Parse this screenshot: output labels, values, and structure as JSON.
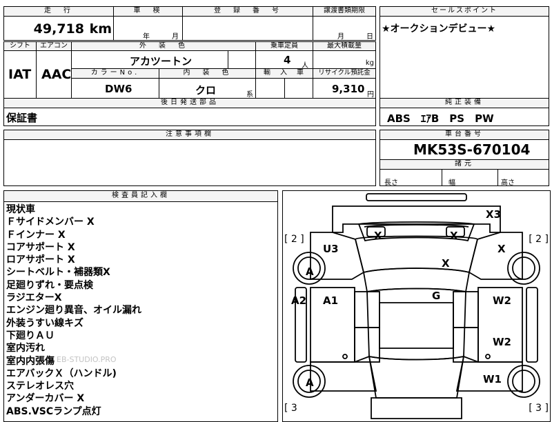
{
  "header": {
    "mileage_label": "走　行",
    "shaken_label": "車　検",
    "registration_label": "登　録　番　号",
    "transfer_label": "譲渡書類期限",
    "sales_label": "セールスポイント",
    "mileage_value": "49,718",
    "mileage_unit": "km",
    "year_unit": "年",
    "month_unit": "月",
    "transfer_month_unit": "月",
    "transfer_day_unit": "日",
    "sales_point": "★オークションデビュー★"
  },
  "spec": {
    "shift_label": "シフト",
    "aircon_label": "エアコン",
    "exterior_color_label": "外　装　色",
    "capacity_label": "乗車定員",
    "max_load_label": "最大積載量",
    "shift": "IAT",
    "aircon": "AAC",
    "exterior_color": "アカツートン",
    "capacity": "4",
    "capacity_unit": "人",
    "load_unit": "kg",
    "color_no_label": "カラーNo.",
    "interior_color_label": "内　装　色",
    "import_label": "輸　入　車",
    "recycle_label": "リサイクル預託金",
    "color_no": "DW6",
    "interior_color": "クロ",
    "interior_suffix": "系",
    "recycle_fee": "9,310",
    "yen_unit": "円"
  },
  "parts": {
    "later_parts_label": "後日発送部品",
    "later_parts": "保証書",
    "equipment_label": "純正装備",
    "equipment": "ABS　ｴｱB　PS　PW"
  },
  "notes": {
    "caution_label": "注意事項欄",
    "chassis_label": "車台番号",
    "chassis_no": "MK53S-670104",
    "dimensions_label": "諸元",
    "length_label": "長さ",
    "width_label": "幅",
    "height_label": "高さ"
  },
  "inspector": {
    "label": "検査員記入欄",
    "lines": [
      "現状車",
      "Ｆサイドメンバー X",
      "Ｆインナー X",
      "コアサポート X",
      "ロアサポート X",
      "シートベルト・補器類X",
      "足廻りずれ・要点検",
      "ラジエターX",
      "エンジン廻り異音、オイル漏れ",
      "外装うすい線キズ",
      "下廻りＡＵ",
      "室内汚れ",
      "室内内張傷",
      "エアバックＸ（ハンドル)",
      "ステレオレス穴",
      "アンダーカバー X",
      "ABS.VSCランプ点灯"
    ],
    "watermark": "EB-STUDIO.PRO"
  },
  "diagram": {
    "marks": {
      "x3": "X3",
      "x_left": "X",
      "x_right": "X",
      "x_fender": "X",
      "x_hood": "X",
      "u3": "U3",
      "a_front": "A",
      "a_rear": "A",
      "a2": "A2",
      "a1": "A1",
      "g": "G",
      "w2_front": "W2",
      "w2_rear": "W2",
      "w1": "W1"
    },
    "brackets": {
      "left_top": "[ 2 ]",
      "right_top": "[ 2 ]",
      "left_bottom": "[ 3",
      "right_bottom": "[ 3 ]"
    }
  }
}
